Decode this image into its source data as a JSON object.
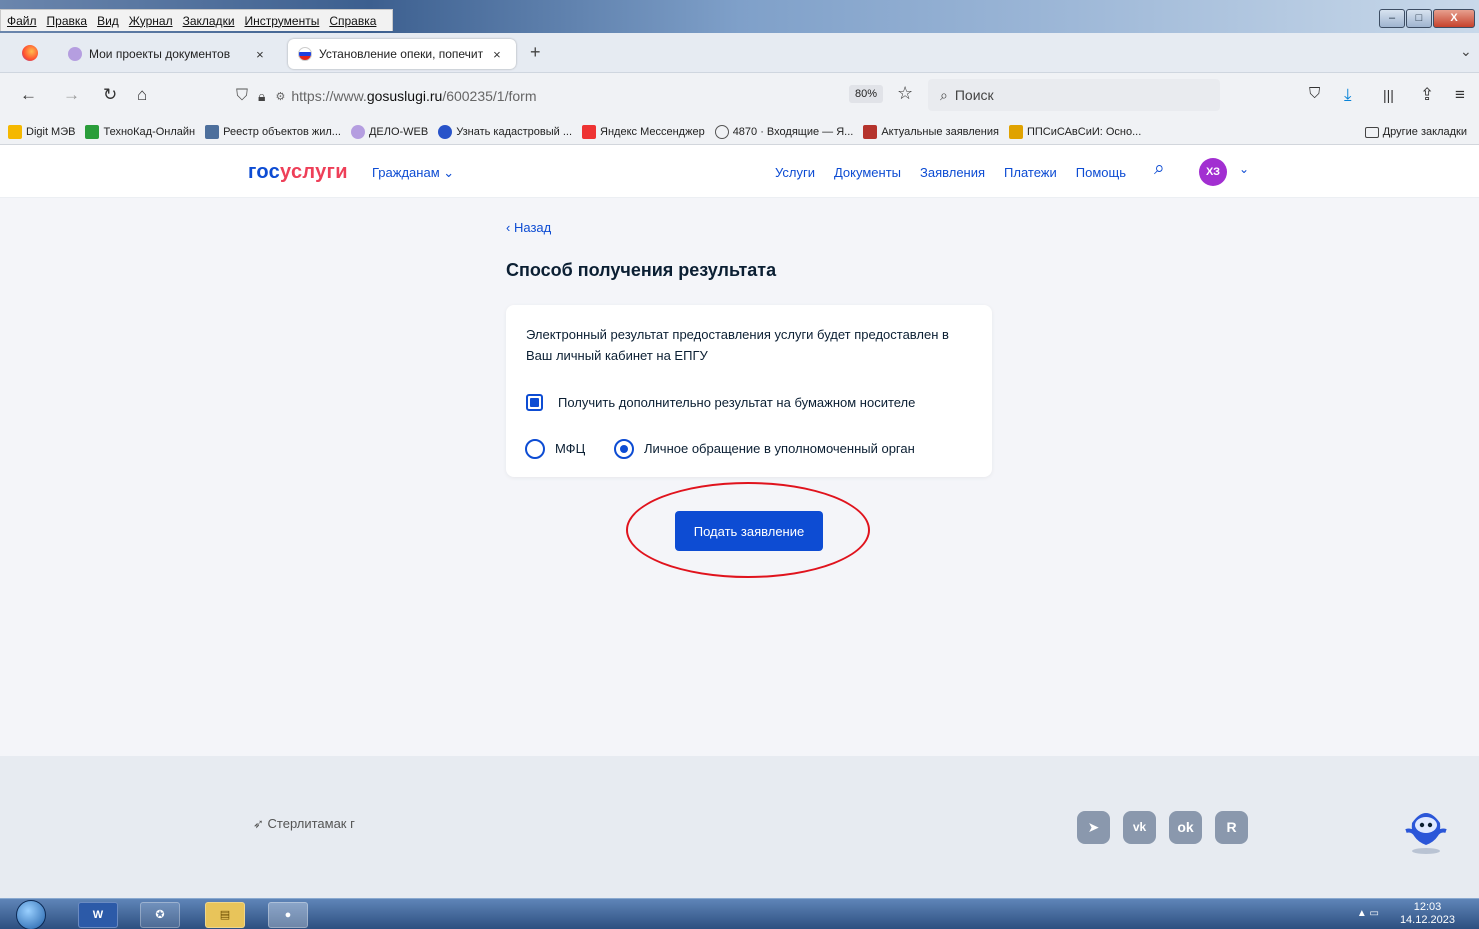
{
  "menubar": {
    "items": [
      "Файл",
      "Правка",
      "Вид",
      "Журнал",
      "Закладки",
      "Инструменты",
      "Справка"
    ],
    "window_buttons": [
      "–",
      "□",
      "X"
    ]
  },
  "tabs": [
    {
      "label": "Мои проекты документов",
      "close": "×"
    },
    {
      "label": "Установление опеки, попечит",
      "close": "×"
    }
  ],
  "new_tab": "+",
  "nav": {
    "url_prefix": "https://www.",
    "url_domain": "gosuslugi.ru",
    "url_path": "/600235/1/form",
    "zoom": "80%",
    "search_placeholder": "Поиск"
  },
  "bookmarks": [
    {
      "label": "Digit МЭВ",
      "color": "#f5b800"
    },
    {
      "label": "ТехноКад-Онлайн",
      "color": "#2a9d3a"
    },
    {
      "label": "Реестр объектов жил...",
      "color": "#4d6f9c"
    },
    {
      "label": "ДЕЛО-WEB",
      "color": "#b58cd6"
    },
    {
      "label": "Узнать кадастровый ...",
      "color": "#2853c9"
    },
    {
      "label": "Яндекс Мессенджер",
      "color": "#e33"
    },
    {
      "label": "4870 · Входящие — Я...",
      "color": "#555"
    },
    {
      "label": "Актуальные заявления",
      "color": "#b5332c"
    },
    {
      "label": "ППСиСАвСиИ: Осно...",
      "color": "#e0a200"
    }
  ],
  "other_bookmarks": "Другие закладки",
  "site": {
    "logo_part1": "гос",
    "logo_part2": "услуги",
    "citizens": "Гражданам",
    "nav": [
      "Услуги",
      "Документы",
      "Заявления",
      "Платежи",
      "Помощь"
    ],
    "avatar": "ХЗ"
  },
  "main": {
    "back": "Назад",
    "title": "Способ получения результата",
    "info": "Электронный результат предоставления услуги будет предоставлен в Ваш личный кабинет на ЕПГУ",
    "checkbox_label": "Получить дополнительно результат на бумажном носителе",
    "checkbox_checked": true,
    "radio_options": [
      "МФЦ",
      "Личное обращение в уполномоченный орган"
    ],
    "radio_selected": "Личное обращение в уполномоченный орган",
    "submit": "Подать заявление"
  },
  "footer": {
    "city": "Стерлитамак г",
    "social": [
      "telegram-icon",
      "vk-icon",
      "odnoklassniki-icon",
      "rutube-icon"
    ]
  },
  "taskbar": {
    "time": "12:03",
    "date": "14.12.2023"
  }
}
